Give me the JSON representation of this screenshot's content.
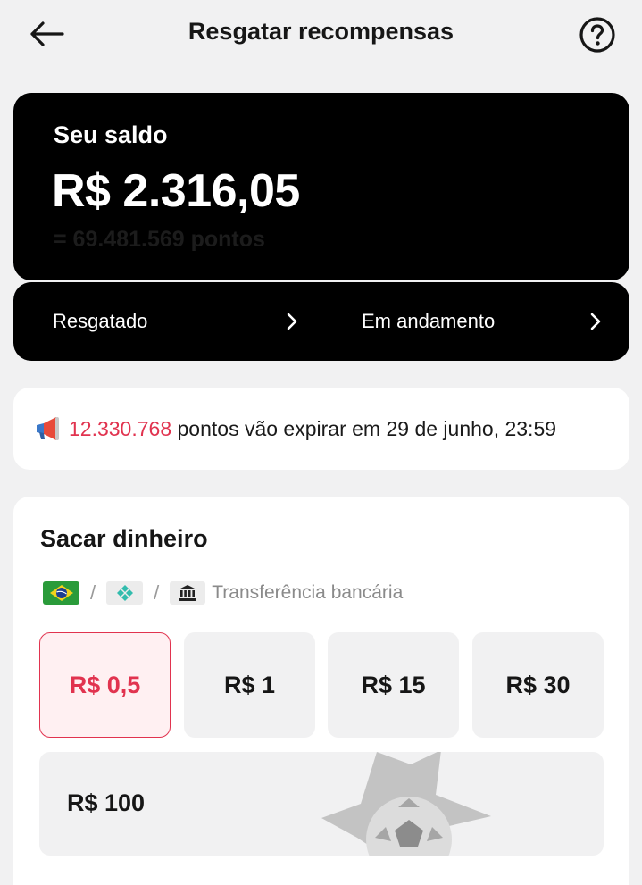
{
  "header": {
    "title": "Resgatar recompensas",
    "back_icon": "arrow-left-icon",
    "help_icon": "question-circle-icon"
  },
  "balance": {
    "label": "Seu saldo",
    "amount": "R$ 2.316,05",
    "points": "= 69.481.569 pontos"
  },
  "links": {
    "redeemed": "Resgatado",
    "in_progress": "Em andamento"
  },
  "notice": {
    "points": "12.330.768",
    "text": " pontos vão expirar em 29 de junho, 23:59",
    "icon": "megaphone-icon",
    "accent": "#e1334f"
  },
  "cash": {
    "title": "Sacar dinheiro",
    "methods": {
      "sep1": "/",
      "sep2": "/",
      "bank_transfer": "Transferência bancária"
    },
    "amounts": [
      "R$ 0,5",
      "R$ 1",
      "R$ 15",
      "R$ 30",
      "R$ 100"
    ],
    "selected_index": 0
  }
}
